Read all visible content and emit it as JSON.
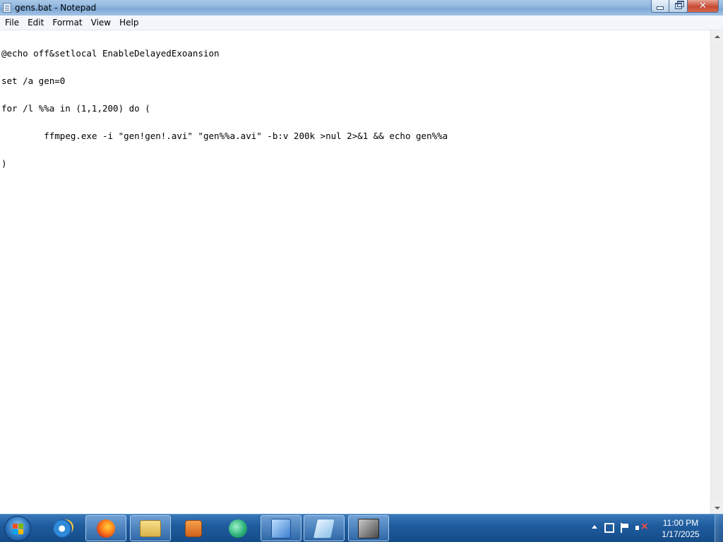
{
  "window": {
    "title": "gens.bat - Notepad"
  },
  "menu": {
    "items": [
      "File",
      "Edit",
      "Format",
      "View",
      "Help"
    ]
  },
  "editor": {
    "lines": [
      "@echo off&setlocal EnableDelayedExoansion",
      "set /a gen=0",
      "for /l %%a in (1,1,200) do (",
      "\tffmpeg.exe -i \"gen!gen!.avi\" \"gen%%a.avi\" -b:v 200k >nul 2>&1 && echo gen%%a",
      ")"
    ]
  },
  "taskbar": {
    "items": [
      {
        "name": "internet-explorer-icon",
        "active": false
      },
      {
        "name": "firefox-icon",
        "active": true
      },
      {
        "name": "file-explorer-icon",
        "active": true
      },
      {
        "name": "media-player-icon",
        "active": false
      },
      {
        "name": "chat-app-icon",
        "active": false
      },
      {
        "name": "tool-app-icon",
        "active": true
      },
      {
        "name": "notepad-icon",
        "active": true
      },
      {
        "name": "cube-app-icon",
        "active": true
      }
    ],
    "clock": {
      "time": "11:00 PM",
      "date": "1/17/2025"
    }
  },
  "colors": {
    "taskbar": "#1f5c9e",
    "close_button": "#c74a34",
    "titlebar": "#8fb6de"
  }
}
